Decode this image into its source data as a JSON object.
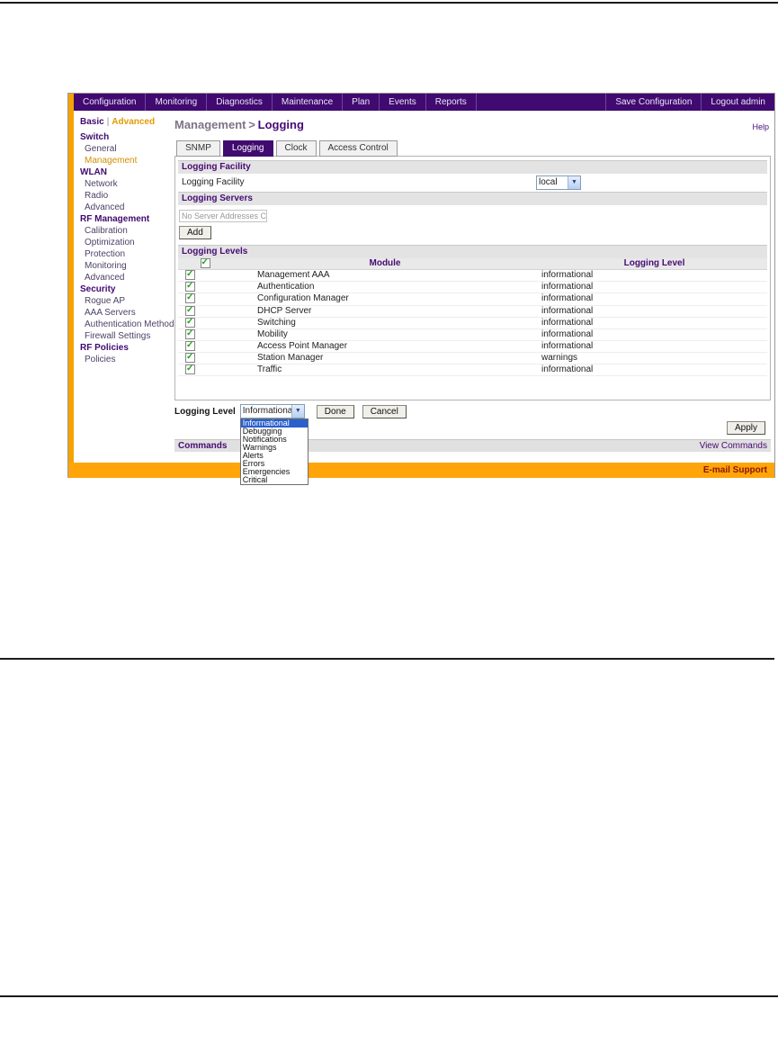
{
  "nav": {
    "items": [
      "Configuration",
      "Monitoring",
      "Diagnostics",
      "Maintenance",
      "Plan",
      "Events",
      "Reports"
    ],
    "active_item": "Configuration",
    "right_items": [
      "Save Configuration",
      "Logout admin"
    ]
  },
  "sidebar": {
    "basic_label": "Basic",
    "mode_separator": "|",
    "advanced_label": "Advanced",
    "selected_item": "Management",
    "groups": [
      {
        "label": "Switch",
        "items": [
          "General",
          "Management"
        ]
      },
      {
        "label": "WLAN",
        "items": [
          "Network",
          "Radio",
          "Advanced"
        ]
      },
      {
        "label": "RF Management",
        "items": [
          "Calibration",
          "Optimization",
          "Protection",
          "Monitoring",
          "Advanced"
        ]
      },
      {
        "label": "Security",
        "items": [
          "Rogue AP",
          "AAA Servers",
          "Authentication Methods",
          "Firewall Settings"
        ]
      },
      {
        "label": "RF Policies",
        "items": [
          "Policies"
        ]
      }
    ]
  },
  "main": {
    "title_parent": "Management",
    "title_separator": ">",
    "title_current": "Logging",
    "help_label": "Help",
    "tabs": [
      "SNMP",
      "Logging",
      "Clock",
      "Access Control"
    ],
    "active_tab": "Logging",
    "facility": {
      "section_title": "Logging Facility",
      "label": "Logging Facility",
      "value": "local"
    },
    "servers": {
      "section_title": "Logging Servers",
      "empty_box_text": "No Server Addresses C",
      "add_button": "Add"
    },
    "levels": {
      "section_title": "Logging Levels",
      "columns": [
        "Module",
        "Logging Level"
      ],
      "header_checked": true,
      "rows": [
        {
          "module": "Management AAA",
          "level": "informational",
          "checked": true
        },
        {
          "module": "Authentication",
          "level": "informational",
          "checked": true
        },
        {
          "module": "Configuration Manager",
          "level": "informational",
          "checked": true
        },
        {
          "module": "DHCP Server",
          "level": "informational",
          "checked": true
        },
        {
          "module": "Switching",
          "level": "informational",
          "checked": true
        },
        {
          "module": "Mobility",
          "level": "informational",
          "checked": true
        },
        {
          "module": "Access Point Manager",
          "level": "informational",
          "checked": true
        },
        {
          "module": "Station Manager",
          "level": "warnings",
          "checked": true
        },
        {
          "module": "Traffic",
          "level": "informational",
          "checked": true
        }
      ]
    },
    "editor": {
      "label": "Logging Level",
      "value": "Informational",
      "options": [
        "Informational",
        "Debugging",
        "Notifications",
        "Warnings",
        "Alerts",
        "Errors",
        "Emergencies",
        "Critical"
      ],
      "highlighted_option": "Informational",
      "done_button": "Done",
      "cancel_button": "Cancel"
    },
    "apply_button": "Apply",
    "commands": {
      "title": "Commands",
      "view_link": "View Commands"
    }
  },
  "footer": {
    "support_link": "E-mail Support"
  },
  "icons": {
    "checkbox_checked": "✓",
    "dropdown_arrow": "▼"
  },
  "colors": {
    "nav_purple": "#400a70",
    "accent_orange": "#F5A302",
    "footer_orange": "#FFA50A",
    "selected_orange": "#D28F00",
    "link_purple": "#470a75",
    "highlight_blue": "#2A5FCC",
    "check_green": "#23A41F",
    "support_text_red": "#8B1500"
  }
}
